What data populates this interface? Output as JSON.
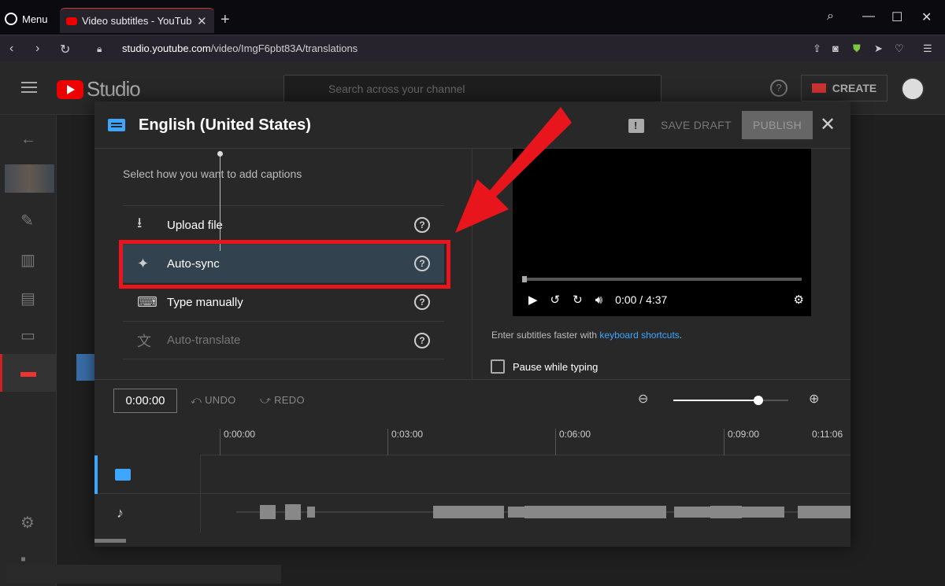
{
  "browser": {
    "menu_label": "Menu",
    "tab_title": "Video subtitles - YouTube Studio",
    "url_domain": "studio.youtube.com",
    "url_path": "/video/ImgF6pbt83A/translations"
  },
  "studio": {
    "logo_text": "Studio",
    "search_placeholder": "Search across your channel",
    "create_label": "CREATE"
  },
  "dialog": {
    "title": "English (United States)",
    "save_draft": "SAVE DRAFT",
    "publish": "PUBLISH",
    "prompt": "Select how you want to add captions",
    "options": [
      {
        "label": "Upload file",
        "icon": "upload-icon",
        "selected": false,
        "disabled": false
      },
      {
        "label": "Auto-sync",
        "icon": "sparkle-icon",
        "selected": true,
        "disabled": false
      },
      {
        "label": "Type manually",
        "icon": "keyboard-icon",
        "selected": false,
        "disabled": false
      },
      {
        "label": "Auto-translate",
        "icon": "translate-icon",
        "selected": false,
        "disabled": true
      }
    ],
    "video_time": "0:00 / 4:37",
    "shortcuts_text": "Enter subtitles faster with ",
    "shortcuts_link": "keyboard shortcuts",
    "shortcuts_end": ".",
    "pause_label": "Pause while typing",
    "pause_checked": false
  },
  "timeline": {
    "timecode": "0:00:00",
    "undo": "UNDO",
    "redo": "REDO",
    "zoom_level": 0.74,
    "ticks": [
      "0:00:00",
      "0:03:00",
      "0:06:00",
      "0:09:00",
      "0:11:06"
    ]
  },
  "colors": {
    "accent_blue": "#3ea6ff",
    "highlight_red": "#e8161c",
    "youtube_red": "#ee0000"
  }
}
